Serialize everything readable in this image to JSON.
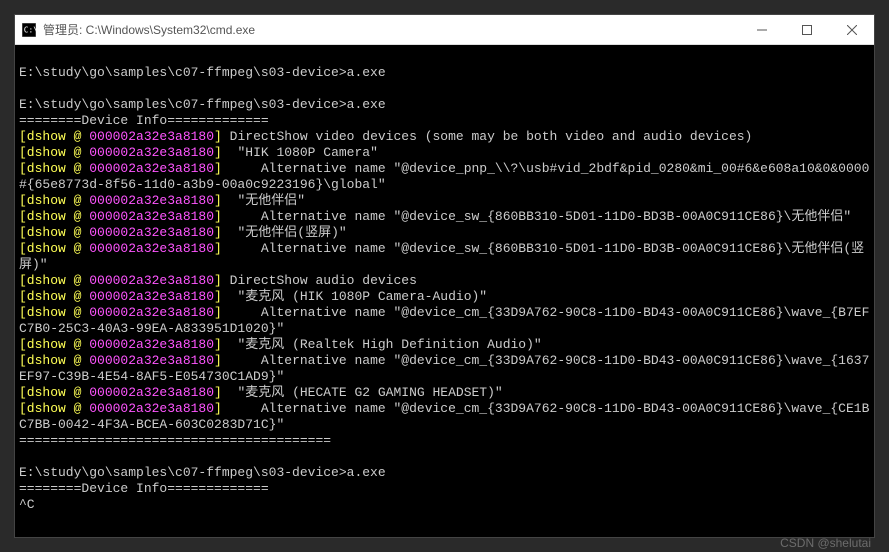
{
  "window": {
    "title": "管理员: C:\\Windows\\System32\\cmd.exe"
  },
  "lines": [
    {
      "segments": [
        {
          "cls": "plain",
          "text": ""
        }
      ]
    },
    {
      "segments": [
        {
          "cls": "prompt",
          "text": "E:\\study\\go\\samples\\c07-ffmpeg\\s03-device>a.exe"
        }
      ]
    },
    {
      "segments": [
        {
          "cls": "plain",
          "text": ""
        }
      ]
    },
    {
      "segments": [
        {
          "cls": "prompt",
          "text": "E:\\study\\go\\samples\\c07-ffmpeg\\s03-device>a.exe"
        }
      ]
    },
    {
      "segments": [
        {
          "cls": "plain",
          "text": "========Device Info============="
        }
      ]
    },
    {
      "segments": [
        {
          "cls": "tag",
          "text": "[dshow @ "
        },
        {
          "cls": "addr",
          "text": "000002a32e3a8180"
        },
        {
          "cls": "tag",
          "text": "]"
        },
        {
          "cls": "plain",
          "text": " DirectShow video devices (some may be both video and audio devices)"
        }
      ]
    },
    {
      "segments": [
        {
          "cls": "tag",
          "text": "[dshow @ "
        },
        {
          "cls": "addr",
          "text": "000002a32e3a8180"
        },
        {
          "cls": "tag",
          "text": "]"
        },
        {
          "cls": "plain",
          "text": "  \"HIK 1080P Camera\""
        }
      ]
    },
    {
      "segments": [
        {
          "cls": "tag",
          "text": "[dshow @ "
        },
        {
          "cls": "addr",
          "text": "000002a32e3a8180"
        },
        {
          "cls": "tag",
          "text": "]"
        },
        {
          "cls": "plain",
          "text": "     Alternative name \"@device_pnp_\\\\?\\usb#vid_2bdf&pid_0280&mi_00#6&e608a10&0&0000#{65e8773d-8f56-11d0-a3b9-00a0c9223196}\\global\""
        }
      ]
    },
    {
      "segments": [
        {
          "cls": "tag",
          "text": "[dshow @ "
        },
        {
          "cls": "addr",
          "text": "000002a32e3a8180"
        },
        {
          "cls": "tag",
          "text": "]"
        },
        {
          "cls": "plain",
          "text": "  \"无他伴侣\""
        }
      ]
    },
    {
      "segments": [
        {
          "cls": "tag",
          "text": "[dshow @ "
        },
        {
          "cls": "addr",
          "text": "000002a32e3a8180"
        },
        {
          "cls": "tag",
          "text": "]"
        },
        {
          "cls": "plain",
          "text": "     Alternative name \"@device_sw_{860BB310-5D01-11D0-BD3B-00A0C911CE86}\\无他伴侣\""
        }
      ]
    },
    {
      "segments": [
        {
          "cls": "tag",
          "text": "[dshow @ "
        },
        {
          "cls": "addr",
          "text": "000002a32e3a8180"
        },
        {
          "cls": "tag",
          "text": "]"
        },
        {
          "cls": "plain",
          "text": "  \"无他伴侣(竖屏)\""
        }
      ]
    },
    {
      "segments": [
        {
          "cls": "tag",
          "text": "[dshow @ "
        },
        {
          "cls": "addr",
          "text": "000002a32e3a8180"
        },
        {
          "cls": "tag",
          "text": "]"
        },
        {
          "cls": "plain",
          "text": "     Alternative name \"@device_sw_{860BB310-5D01-11D0-BD3B-00A0C911CE86}\\无他伴侣(竖屏)\""
        }
      ]
    },
    {
      "segments": [
        {
          "cls": "tag",
          "text": "[dshow @ "
        },
        {
          "cls": "addr",
          "text": "000002a32e3a8180"
        },
        {
          "cls": "tag",
          "text": "]"
        },
        {
          "cls": "plain",
          "text": " DirectShow audio devices"
        }
      ]
    },
    {
      "segments": [
        {
          "cls": "tag",
          "text": "[dshow @ "
        },
        {
          "cls": "addr",
          "text": "000002a32e3a8180"
        },
        {
          "cls": "tag",
          "text": "]"
        },
        {
          "cls": "plain",
          "text": "  \"麦克风 (HIK 1080P Camera-Audio)\""
        }
      ]
    },
    {
      "segments": [
        {
          "cls": "tag",
          "text": "[dshow @ "
        },
        {
          "cls": "addr",
          "text": "000002a32e3a8180"
        },
        {
          "cls": "tag",
          "text": "]"
        },
        {
          "cls": "plain",
          "text": "     Alternative name \"@device_cm_{33D9A762-90C8-11D0-BD43-00A0C911CE86}\\wave_{B7EFC7B0-25C3-40A3-99EA-A833951D1020}\""
        }
      ]
    },
    {
      "segments": [
        {
          "cls": "tag",
          "text": "[dshow @ "
        },
        {
          "cls": "addr",
          "text": "000002a32e3a8180"
        },
        {
          "cls": "tag",
          "text": "]"
        },
        {
          "cls": "plain",
          "text": "  \"麦克风 (Realtek High Definition Audio)\""
        }
      ]
    },
    {
      "segments": [
        {
          "cls": "tag",
          "text": "[dshow @ "
        },
        {
          "cls": "addr",
          "text": "000002a32e3a8180"
        },
        {
          "cls": "tag",
          "text": "]"
        },
        {
          "cls": "plain",
          "text": "     Alternative name \"@device_cm_{33D9A762-90C8-11D0-BD43-00A0C911CE86}\\wave_{1637EF97-C39B-4E54-8AF5-E054730C1AD9}\""
        }
      ]
    },
    {
      "segments": [
        {
          "cls": "tag",
          "text": "[dshow @ "
        },
        {
          "cls": "addr",
          "text": "000002a32e3a8180"
        },
        {
          "cls": "tag",
          "text": "]"
        },
        {
          "cls": "plain",
          "text": "  \"麦克风 (HECATE G2 GAMING HEADSET)\""
        }
      ]
    },
    {
      "segments": [
        {
          "cls": "tag",
          "text": "[dshow @ "
        },
        {
          "cls": "addr",
          "text": "000002a32e3a8180"
        },
        {
          "cls": "tag",
          "text": "]"
        },
        {
          "cls": "plain",
          "text": "     Alternative name \"@device_cm_{33D9A762-90C8-11D0-BD43-00A0C911CE86}\\wave_{CE1BC7BB-0042-4F3A-BCEA-603C0283D71C}\""
        }
      ]
    },
    {
      "segments": [
        {
          "cls": "plain",
          "text": "========================================"
        }
      ]
    },
    {
      "segments": [
        {
          "cls": "plain",
          "text": ""
        }
      ]
    },
    {
      "segments": [
        {
          "cls": "prompt",
          "text": "E:\\study\\go\\samples\\c07-ffmpeg\\s03-device>a.exe"
        }
      ]
    },
    {
      "segments": [
        {
          "cls": "plain",
          "text": "========Device Info============="
        }
      ]
    },
    {
      "segments": [
        {
          "cls": "plain",
          "text": "^C"
        }
      ]
    }
  ],
  "watermark": "CSDN @shelutai"
}
